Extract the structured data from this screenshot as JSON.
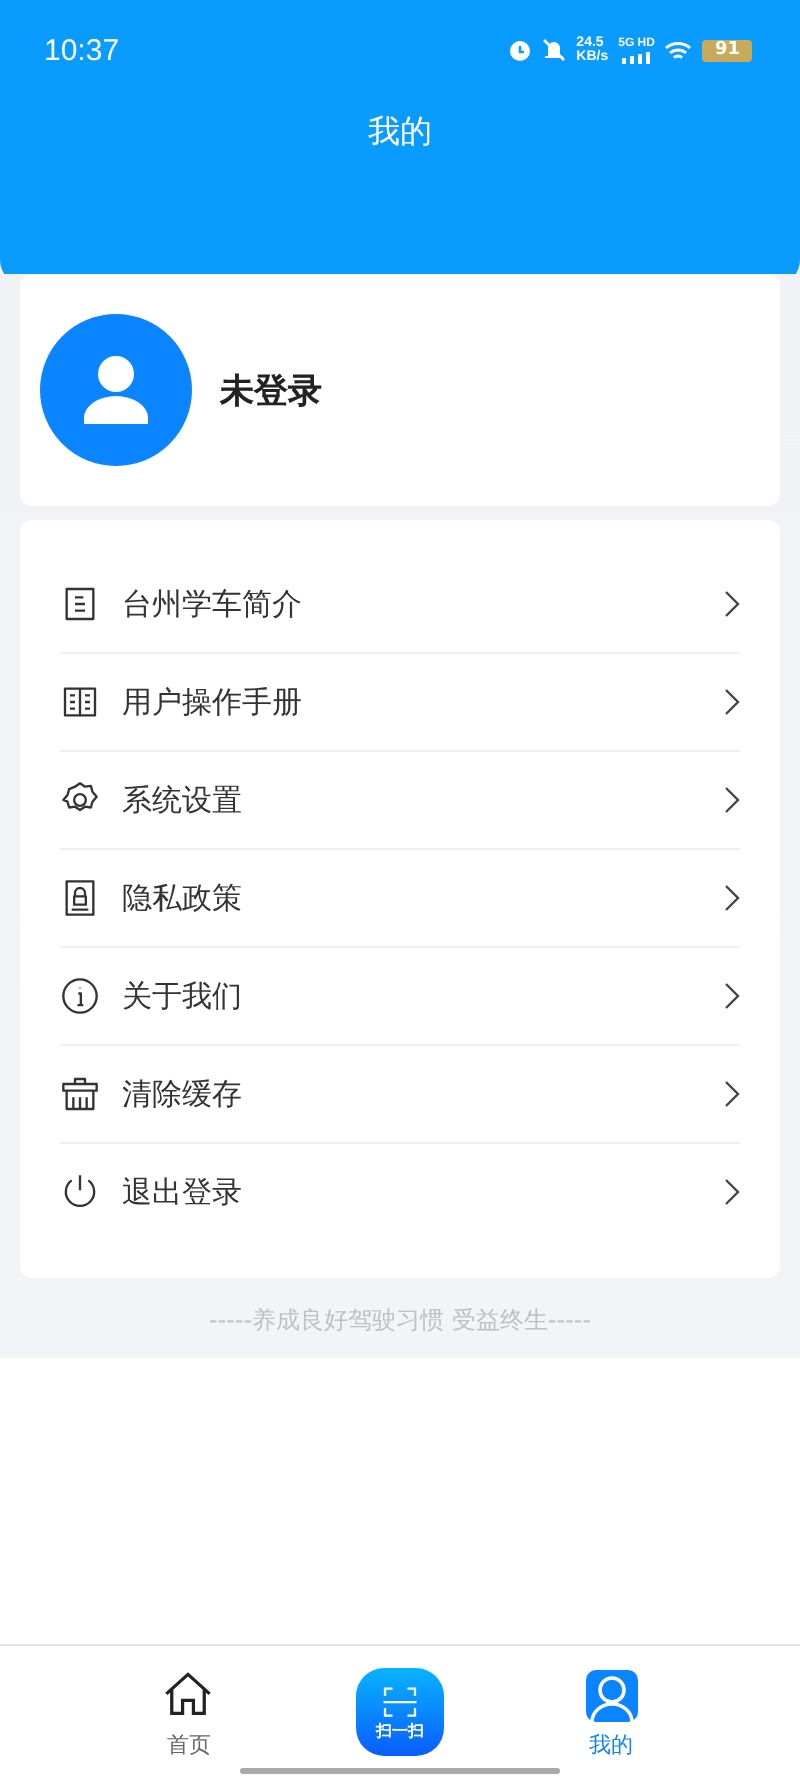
{
  "status_bar": {
    "time": "10:37",
    "speed": "24.5",
    "speed_unit": "KB/s",
    "network": "5G HD",
    "battery": "91"
  },
  "header": {
    "title": "我的"
  },
  "profile": {
    "name": "未登录"
  },
  "menu": [
    {
      "label": "台州学车简介"
    },
    {
      "label": "用户操作手册"
    },
    {
      "label": "系统设置"
    },
    {
      "label": "隐私政策"
    },
    {
      "label": "关于我们"
    },
    {
      "label": "清除缓存"
    },
    {
      "label": "退出登录"
    }
  ],
  "footer_text": "-----养成良好驾驶习惯 受益终生-----",
  "tab_bar": [
    {
      "kind": "tab",
      "label": "首页",
      "selected": false
    },
    {
      "kind": "scan",
      "label": "扫一扫",
      "selected": false
    },
    {
      "kind": "tab",
      "label": "我的",
      "selected": true
    }
  ]
}
